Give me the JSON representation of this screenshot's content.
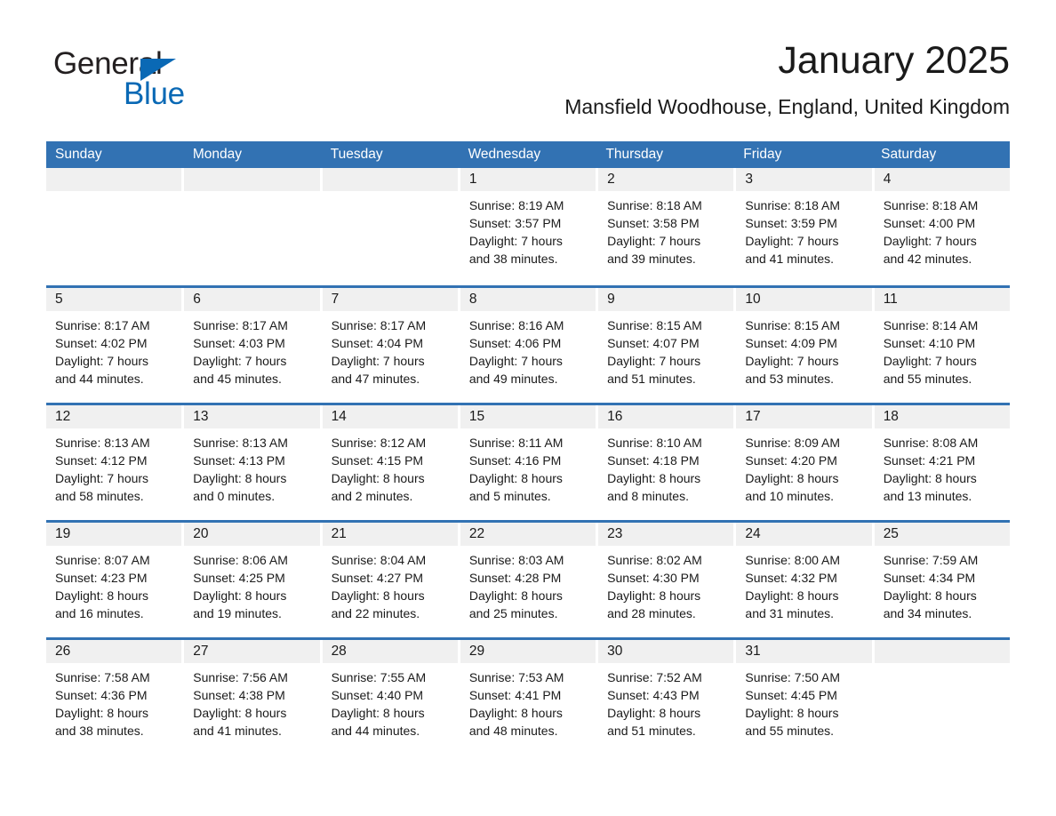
{
  "brand": {
    "name_part1": "General",
    "name_part2": "Blue",
    "accent_color": "#0a69b5"
  },
  "header": {
    "title": "January 2025",
    "subtitle": "Mansfield Woodhouse, England, United Kingdom"
  },
  "calendar": {
    "header_bg": "#3272b3",
    "daynum_bg": "#f0f0f0",
    "weekdays": [
      "Sunday",
      "Monday",
      "Tuesday",
      "Wednesday",
      "Thursday",
      "Friday",
      "Saturday"
    ],
    "weeks": [
      [
        {
          "day": "",
          "empty": true
        },
        {
          "day": "",
          "empty": true
        },
        {
          "day": "",
          "empty": true
        },
        {
          "day": "1",
          "sunrise": "Sunrise: 8:19 AM",
          "sunset": "Sunset: 3:57 PM",
          "daylight_line1": "Daylight: 7 hours",
          "daylight_line2": "and 38 minutes."
        },
        {
          "day": "2",
          "sunrise": "Sunrise: 8:18 AM",
          "sunset": "Sunset: 3:58 PM",
          "daylight_line1": "Daylight: 7 hours",
          "daylight_line2": "and 39 minutes."
        },
        {
          "day": "3",
          "sunrise": "Sunrise: 8:18 AM",
          "sunset": "Sunset: 3:59 PM",
          "daylight_line1": "Daylight: 7 hours",
          "daylight_line2": "and 41 minutes."
        },
        {
          "day": "4",
          "sunrise": "Sunrise: 8:18 AM",
          "sunset": "Sunset: 4:00 PM",
          "daylight_line1": "Daylight: 7 hours",
          "daylight_line2": "and 42 minutes."
        }
      ],
      [
        {
          "day": "5",
          "sunrise": "Sunrise: 8:17 AM",
          "sunset": "Sunset: 4:02 PM",
          "daylight_line1": "Daylight: 7 hours",
          "daylight_line2": "and 44 minutes."
        },
        {
          "day": "6",
          "sunrise": "Sunrise: 8:17 AM",
          "sunset": "Sunset: 4:03 PM",
          "daylight_line1": "Daylight: 7 hours",
          "daylight_line2": "and 45 minutes."
        },
        {
          "day": "7",
          "sunrise": "Sunrise: 8:17 AM",
          "sunset": "Sunset: 4:04 PM",
          "daylight_line1": "Daylight: 7 hours",
          "daylight_line2": "and 47 minutes."
        },
        {
          "day": "8",
          "sunrise": "Sunrise: 8:16 AM",
          "sunset": "Sunset: 4:06 PM",
          "daylight_line1": "Daylight: 7 hours",
          "daylight_line2": "and 49 minutes."
        },
        {
          "day": "9",
          "sunrise": "Sunrise: 8:15 AM",
          "sunset": "Sunset: 4:07 PM",
          "daylight_line1": "Daylight: 7 hours",
          "daylight_line2": "and 51 minutes."
        },
        {
          "day": "10",
          "sunrise": "Sunrise: 8:15 AM",
          "sunset": "Sunset: 4:09 PM",
          "daylight_line1": "Daylight: 7 hours",
          "daylight_line2": "and 53 minutes."
        },
        {
          "day": "11",
          "sunrise": "Sunrise: 8:14 AM",
          "sunset": "Sunset: 4:10 PM",
          "daylight_line1": "Daylight: 7 hours",
          "daylight_line2": "and 55 minutes."
        }
      ],
      [
        {
          "day": "12",
          "sunrise": "Sunrise: 8:13 AM",
          "sunset": "Sunset: 4:12 PM",
          "daylight_line1": "Daylight: 7 hours",
          "daylight_line2": "and 58 minutes."
        },
        {
          "day": "13",
          "sunrise": "Sunrise: 8:13 AM",
          "sunset": "Sunset: 4:13 PM",
          "daylight_line1": "Daylight: 8 hours",
          "daylight_line2": "and 0 minutes."
        },
        {
          "day": "14",
          "sunrise": "Sunrise: 8:12 AM",
          "sunset": "Sunset: 4:15 PM",
          "daylight_line1": "Daylight: 8 hours",
          "daylight_line2": "and 2 minutes."
        },
        {
          "day": "15",
          "sunrise": "Sunrise: 8:11 AM",
          "sunset": "Sunset: 4:16 PM",
          "daylight_line1": "Daylight: 8 hours",
          "daylight_line2": "and 5 minutes."
        },
        {
          "day": "16",
          "sunrise": "Sunrise: 8:10 AM",
          "sunset": "Sunset: 4:18 PM",
          "daylight_line1": "Daylight: 8 hours",
          "daylight_line2": "and 8 minutes."
        },
        {
          "day": "17",
          "sunrise": "Sunrise: 8:09 AM",
          "sunset": "Sunset: 4:20 PM",
          "daylight_line1": "Daylight: 8 hours",
          "daylight_line2": "and 10 minutes."
        },
        {
          "day": "18",
          "sunrise": "Sunrise: 8:08 AM",
          "sunset": "Sunset: 4:21 PM",
          "daylight_line1": "Daylight: 8 hours",
          "daylight_line2": "and 13 minutes."
        }
      ],
      [
        {
          "day": "19",
          "sunrise": "Sunrise: 8:07 AM",
          "sunset": "Sunset: 4:23 PM",
          "daylight_line1": "Daylight: 8 hours",
          "daylight_line2": "and 16 minutes."
        },
        {
          "day": "20",
          "sunrise": "Sunrise: 8:06 AM",
          "sunset": "Sunset: 4:25 PM",
          "daylight_line1": "Daylight: 8 hours",
          "daylight_line2": "and 19 minutes."
        },
        {
          "day": "21",
          "sunrise": "Sunrise: 8:04 AM",
          "sunset": "Sunset: 4:27 PM",
          "daylight_line1": "Daylight: 8 hours",
          "daylight_line2": "and 22 minutes."
        },
        {
          "day": "22",
          "sunrise": "Sunrise: 8:03 AM",
          "sunset": "Sunset: 4:28 PM",
          "daylight_line1": "Daylight: 8 hours",
          "daylight_line2": "and 25 minutes."
        },
        {
          "day": "23",
          "sunrise": "Sunrise: 8:02 AM",
          "sunset": "Sunset: 4:30 PM",
          "daylight_line1": "Daylight: 8 hours",
          "daylight_line2": "and 28 minutes."
        },
        {
          "day": "24",
          "sunrise": "Sunrise: 8:00 AM",
          "sunset": "Sunset: 4:32 PM",
          "daylight_line1": "Daylight: 8 hours",
          "daylight_line2": "and 31 minutes."
        },
        {
          "day": "25",
          "sunrise": "Sunrise: 7:59 AM",
          "sunset": "Sunset: 4:34 PM",
          "daylight_line1": "Daylight: 8 hours",
          "daylight_line2": "and 34 minutes."
        }
      ],
      [
        {
          "day": "26",
          "sunrise": "Sunrise: 7:58 AM",
          "sunset": "Sunset: 4:36 PM",
          "daylight_line1": "Daylight: 8 hours",
          "daylight_line2": "and 38 minutes."
        },
        {
          "day": "27",
          "sunrise": "Sunrise: 7:56 AM",
          "sunset": "Sunset: 4:38 PM",
          "daylight_line1": "Daylight: 8 hours",
          "daylight_line2": "and 41 minutes."
        },
        {
          "day": "28",
          "sunrise": "Sunrise: 7:55 AM",
          "sunset": "Sunset: 4:40 PM",
          "daylight_line1": "Daylight: 8 hours",
          "daylight_line2": "and 44 minutes."
        },
        {
          "day": "29",
          "sunrise": "Sunrise: 7:53 AM",
          "sunset": "Sunset: 4:41 PM",
          "daylight_line1": "Daylight: 8 hours",
          "daylight_line2": "and 48 minutes."
        },
        {
          "day": "30",
          "sunrise": "Sunrise: 7:52 AM",
          "sunset": "Sunset: 4:43 PM",
          "daylight_line1": "Daylight: 8 hours",
          "daylight_line2": "and 51 minutes."
        },
        {
          "day": "31",
          "sunrise": "Sunrise: 7:50 AM",
          "sunset": "Sunset: 4:45 PM",
          "daylight_line1": "Daylight: 8 hours",
          "daylight_line2": "and 55 minutes."
        },
        {
          "day": "",
          "empty": true
        }
      ]
    ]
  }
}
